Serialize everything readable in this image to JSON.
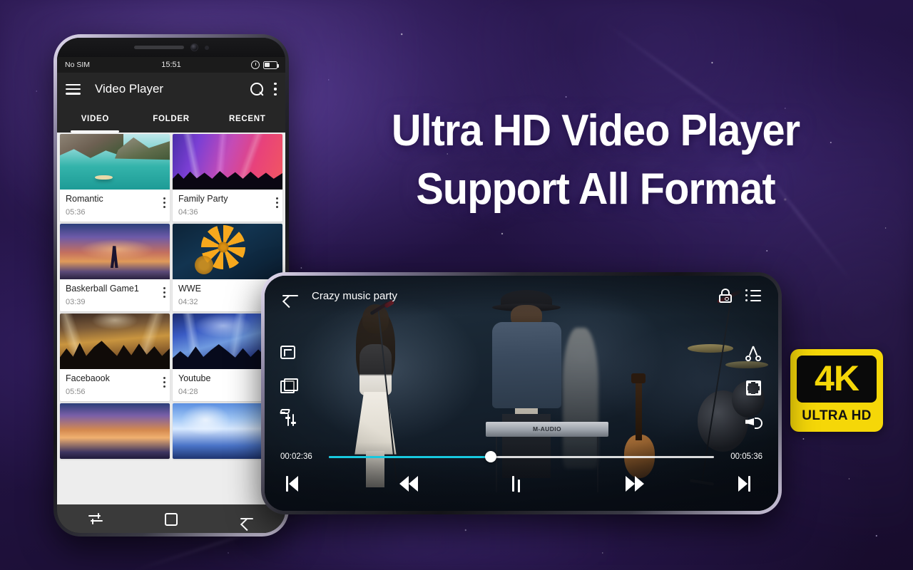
{
  "headline": {
    "line1": "Ultra HD Video Player",
    "line2": "Support All Format"
  },
  "badge": {
    "resolution": "4K",
    "subtitle": "ULTRA HD",
    "color": "#f5d708"
  },
  "left_phone": {
    "status_bar": {
      "carrier": "No SIM",
      "time": "15:51",
      "alarm_icon": "alarm-icon",
      "battery_icon": "battery-icon"
    },
    "app_bar": {
      "menu_icon": "hamburger-menu-icon",
      "title": "Video Player",
      "search_icon": "search-icon",
      "overflow_icon": "more-vertical-icon"
    },
    "tabs": [
      {
        "label": "VIDEO",
        "active": true
      },
      {
        "label": "FOLDER",
        "active": false
      },
      {
        "label": "RECENT",
        "active": false
      }
    ],
    "videos": [
      {
        "title": "Romantic",
        "duration": "05:36",
        "thumb": "th-lake"
      },
      {
        "title": "Family Party",
        "duration": "04:36",
        "thumb": "th-concert"
      },
      {
        "title": "Baskerball Game1",
        "duration": "03:39",
        "thumb": "th-sunset"
      },
      {
        "title": "WWE",
        "duration": "04:32",
        "thumb": "th-flower"
      },
      {
        "title": "Facebaook",
        "duration": "05:56",
        "thumb": "th-crowd"
      },
      {
        "title": "Youtube",
        "duration": "04:28",
        "thumb": "th-stage"
      }
    ],
    "nav_bar": {
      "recents_icon": "recents-icon",
      "home_icon": "home-icon",
      "back_icon": "back-icon"
    }
  },
  "right_phone": {
    "player": {
      "back_icon": "back-arrow-icon",
      "title": "Crazy music party",
      "lock_icon": "unlock-icon",
      "playlist_icon": "playlist-icon",
      "left_tools": [
        {
          "icon": "crop-screenshot-icon"
        },
        {
          "icon": "picture-in-picture-icon"
        },
        {
          "icon": "equalizer-icon"
        }
      ],
      "right_tools": [
        {
          "icon": "scissors-cut-icon"
        },
        {
          "icon": "fullscreen-icon"
        },
        {
          "icon": "volume-icon"
        }
      ],
      "current_time": "00:02:36",
      "total_time": "00:05:36",
      "progress_percent": 42,
      "progress_color": "#18c8de",
      "controls": [
        {
          "name": "previous",
          "icon": "skip-previous-icon"
        },
        {
          "name": "rewind",
          "icon": "rewind-icon"
        },
        {
          "name": "pause",
          "icon": "pause-icon"
        },
        {
          "name": "forward",
          "icon": "fast-forward-icon"
        },
        {
          "name": "next",
          "icon": "skip-next-icon"
        }
      ],
      "scene": {
        "keyboard_brand": "M-AUDIO"
      }
    }
  }
}
